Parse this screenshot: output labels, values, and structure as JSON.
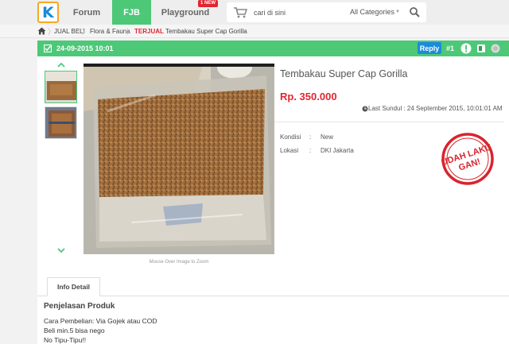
{
  "nav": {
    "logo_letter": "K",
    "tabs": [
      {
        "label": "Forum"
      },
      {
        "label": "FJB"
      },
      {
        "label": "Playground"
      }
    ],
    "new_badge": "1 NEW"
  },
  "search": {
    "placeholder": "cari di sini",
    "category": "All Categories"
  },
  "breadcrumb": {
    "items": [
      "JUAL BELI",
      "Flora & Fauna"
    ],
    "tag": "TERJUAL",
    "current": "Tembakau Super Cap Gorilla"
  },
  "post": {
    "date": "24-09-2015 10:01",
    "reply_label": "Reply",
    "number": "#1"
  },
  "product": {
    "title": "Tembakau Super Cap Gorilla",
    "price": "Rp. 350.000",
    "last_bump": "Last Sundul : 24 September 2015, 10:01:01 AM",
    "zoom_hint": "Mouse Over Image to Zoom",
    "specs": [
      {
        "label": "Kondisi",
        "value": "New"
      },
      {
        "label": "Lokasi",
        "value": "DKI Jakarta"
      }
    ],
    "sold_stamp": [
      "UDAH LAKU",
      "GAN!"
    ]
  },
  "detail": {
    "tab_label": "Info Detail",
    "heading": "Penjelasan Produk",
    "lines": [
      "Cara Pembelian: Via Gojek atau COD",
      "Beli min.5 bisa nego",
      "No Tipu-Tipu!!"
    ]
  },
  "colors": {
    "brand_green": "#4cc877",
    "price_red": "#e0262f",
    "reply_blue": "#1a8cd8"
  }
}
